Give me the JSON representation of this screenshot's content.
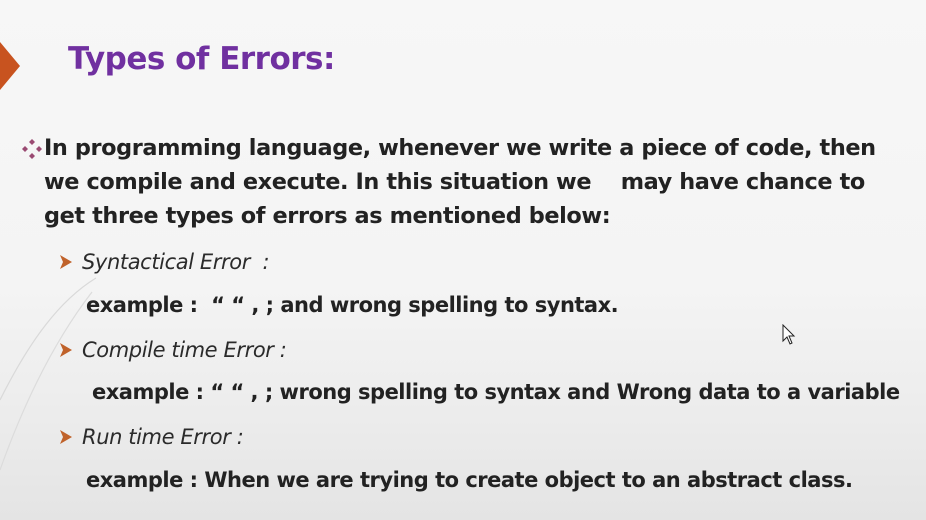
{
  "slide": {
    "title": "Types of Errors:",
    "intro": "In programming language, whenever we write a piece of code, then\nwe compile and execute. In this situation we    may have chance to\nget three types of errors as mentioned below:",
    "items": [
      {
        "label": "Syntactical Error  :",
        "example": "example :  “ “ , ; and wrong spelling to syntax."
      },
      {
        "label": "Compile time Error :",
        "example": "example : “ “ , ; wrong spelling to syntax and Wrong data to a variable"
      },
      {
        "label": "Run time Error :",
        "example": "example : When we are trying to create object to an abstract class."
      }
    ]
  },
  "icons": {
    "accent_tab": "arrow-tab-icon",
    "bullet_primary": "diamond-bullet-icon",
    "bullet_secondary": "arrow-bullet-icon",
    "cursor": "mouse-cursor-icon"
  },
  "colors": {
    "title": "#7030a0",
    "accent": "#c8531f",
    "text": "#222222",
    "bullet_primary": "#9a4a72",
    "bullet_secondary": "#c0622a"
  }
}
